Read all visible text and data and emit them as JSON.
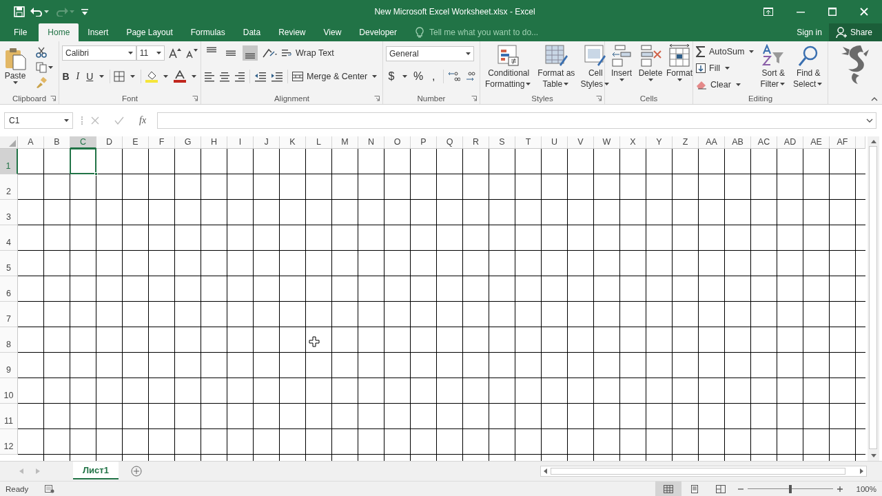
{
  "window": {
    "title": "New Microsoft Excel Worksheet.xlsx - Excel"
  },
  "tabs": [
    {
      "label": "File",
      "selected": false
    },
    {
      "label": "Home",
      "selected": true
    },
    {
      "label": "Insert",
      "selected": false
    },
    {
      "label": "Page Layout",
      "selected": false
    },
    {
      "label": "Formulas",
      "selected": false
    },
    {
      "label": "Data",
      "selected": false
    },
    {
      "label": "Review",
      "selected": false
    },
    {
      "label": "View",
      "selected": false
    },
    {
      "label": "Developer",
      "selected": false
    }
  ],
  "tell_me": {
    "placeholder": "Tell me what you want to do..."
  },
  "account": {
    "sign_in": "Sign in",
    "share": "Share"
  },
  "ribbon": {
    "clipboard": {
      "label": "Clipboard",
      "paste": "Paste"
    },
    "font": {
      "label": "Font",
      "font_name": "Calibri",
      "font_size": "11",
      "bold": "B",
      "italic": "I",
      "underline": "U"
    },
    "alignment": {
      "label": "Alignment",
      "vertical_align": [
        {
          "selected": false
        },
        {
          "selected": false
        },
        {
          "selected": true
        }
      ],
      "wrap_text": "Wrap Text",
      "merge_center": "Merge & Center"
    },
    "number": {
      "label": "Number",
      "format": "General",
      "currency": "$",
      "percent": "%",
      "comma": ","
    },
    "styles": {
      "label": "Styles",
      "buttons": [
        {
          "lines": [
            "Conditional",
            "Formatting"
          ]
        },
        {
          "lines": [
            "Format as",
            "Table"
          ]
        },
        {
          "lines": [
            "Cell",
            "Styles"
          ]
        }
      ]
    },
    "cells": {
      "label": "Cells",
      "buttons": [
        "Insert",
        "Delete",
        "Format"
      ]
    },
    "editing": {
      "label": "Editing",
      "autosum": "AutoSum",
      "fill": "Fill",
      "clear": "Clear",
      "sort_filter": [
        "Sort &",
        "Filter"
      ],
      "find_select": [
        "Find &",
        "Select"
      ]
    }
  },
  "formula_bar": {
    "name_box": "C1",
    "function_label": "fx"
  },
  "columns": [
    {
      "label": "A",
      "selected": false
    },
    {
      "label": "B",
      "selected": false
    },
    {
      "label": "C",
      "selected": true
    },
    {
      "label": "D",
      "selected": false
    },
    {
      "label": "E",
      "selected": false
    },
    {
      "label": "F",
      "selected": false
    },
    {
      "label": "G",
      "selected": false
    },
    {
      "label": "H",
      "selected": false
    },
    {
      "label": "I",
      "selected": false
    },
    {
      "label": "J",
      "selected": false
    },
    {
      "label": "K",
      "selected": false
    },
    {
      "label": "L",
      "selected": false
    },
    {
      "label": "M",
      "selected": false
    },
    {
      "label": "N",
      "selected": false
    },
    {
      "label": "O",
      "selected": false
    },
    {
      "label": "P",
      "selected": false
    },
    {
      "label": "Q",
      "selected": false
    },
    {
      "label": "R",
      "selected": false
    },
    {
      "label": "S",
      "selected": false
    },
    {
      "label": "T",
      "selected": false
    },
    {
      "label": "U",
      "selected": false
    },
    {
      "label": "V",
      "selected": false
    },
    {
      "label": "W",
      "selected": false
    },
    {
      "label": "X",
      "selected": false
    },
    {
      "label": "Y",
      "selected": false
    },
    {
      "label": "Z",
      "selected": false
    },
    {
      "label": "AA",
      "selected": false
    },
    {
      "label": "AB",
      "selected": false
    },
    {
      "label": "AC",
      "selected": false
    },
    {
      "label": "AD",
      "selected": false
    },
    {
      "label": "AE",
      "selected": false
    },
    {
      "label": "AF",
      "selected": false
    }
  ],
  "rows": [
    {
      "label": "1",
      "selected": true
    },
    {
      "label": "2",
      "selected": false
    },
    {
      "label": "3",
      "selected": false
    },
    {
      "label": "4",
      "selected": false
    },
    {
      "label": "5",
      "selected": false
    },
    {
      "label": "6",
      "selected": false
    },
    {
      "label": "7",
      "selected": false
    },
    {
      "label": "8",
      "selected": false
    },
    {
      "label": "9",
      "selected": false
    },
    {
      "label": "10",
      "selected": false
    },
    {
      "label": "11",
      "selected": false
    },
    {
      "label": "12",
      "selected": false
    }
  ],
  "sheets": [
    {
      "label": "Лист1",
      "selected": true
    }
  ],
  "status_bar": {
    "status": "Ready",
    "views": [
      {
        "selected": true
      },
      {
        "selected": false
      },
      {
        "selected": false
      }
    ],
    "zoom_slider": {
      "level": 0.5
    },
    "zoom": "100%"
  }
}
